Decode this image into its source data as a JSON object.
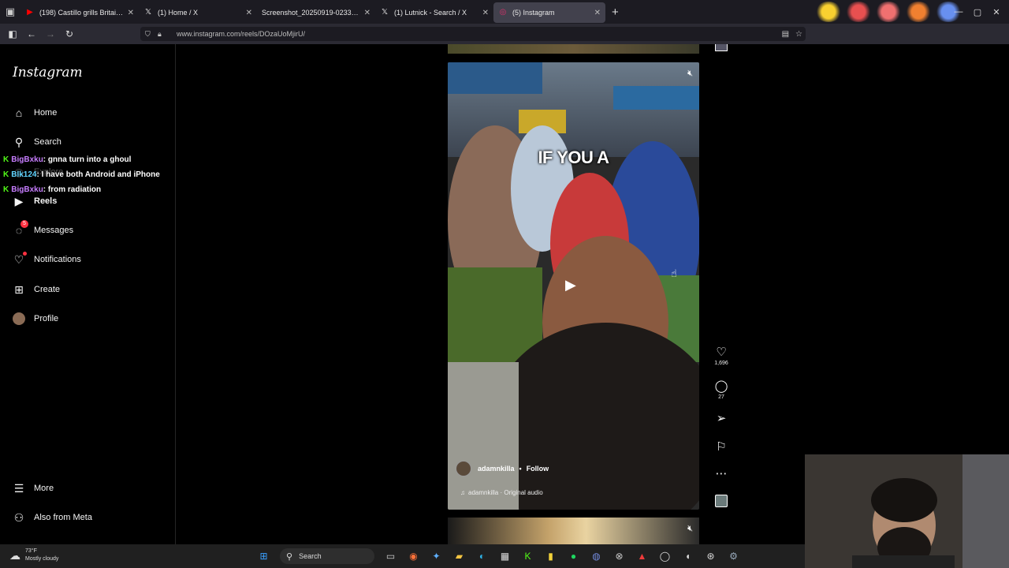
{
  "browser": {
    "tabs": [
      {
        "label": "(198) Castillo grills Britains bigg",
        "favicon": "youtube-icon",
        "color": "#ff0000"
      },
      {
        "label": "(1) Home / X",
        "favicon": "x-icon",
        "color": "#ffffff"
      },
      {
        "label": "Screenshot_20250919-023352.png",
        "favicon": "image-icon",
        "color": "#cccccc"
      },
      {
        "label": "(1) Lutnick - Search / X",
        "favicon": "x-icon",
        "color": "#ffffff"
      },
      {
        "label": "(5) Instagram",
        "favicon": "instagram-icon",
        "color": "#e1306c",
        "active": true
      }
    ],
    "url": "www.instagram.com/reels/DOzaUoMjirU/"
  },
  "instagram": {
    "logo": "Instagram",
    "nav": [
      {
        "id": "home",
        "label": "Home",
        "icon": "home-icon"
      },
      {
        "id": "search",
        "label": "Search",
        "icon": "search-icon"
      },
      {
        "id": "explore",
        "label": "Explore",
        "icon": "compass-icon"
      },
      {
        "id": "reels",
        "label": "Reels",
        "icon": "reels-icon"
      },
      {
        "id": "messages",
        "label": "Messages",
        "icon": "messenger-icon",
        "badge": "5"
      },
      {
        "id": "notifications",
        "label": "Notifications",
        "icon": "heart-icon"
      },
      {
        "id": "create",
        "label": "Create",
        "icon": "plus-square-icon"
      },
      {
        "id": "profile",
        "label": "Profile",
        "icon": "avatar"
      }
    ],
    "more": "More",
    "meta": "Also from Meta"
  },
  "chat": [
    {
      "user": "BigBxku",
      "message": ": gnna turn into a ghoul"
    },
    {
      "user": "Blk124",
      "message": ": I have both Android and iPhone"
    },
    {
      "user": "BigBxku",
      "message": ": from radiation"
    }
  ],
  "reel": {
    "caption": "IF YOU A",
    "username": "adamnkilla",
    "separator": "•",
    "follow": "Follow",
    "audio": "adamnkilla · Original audio",
    "likes": "1,696",
    "comments": "27"
  },
  "taskbar": {
    "temp": "73°F",
    "condition": "Mostly cloudy",
    "search": "Search"
  },
  "colors": {
    "accent": "#ff3040",
    "kick": "#53fc18"
  }
}
